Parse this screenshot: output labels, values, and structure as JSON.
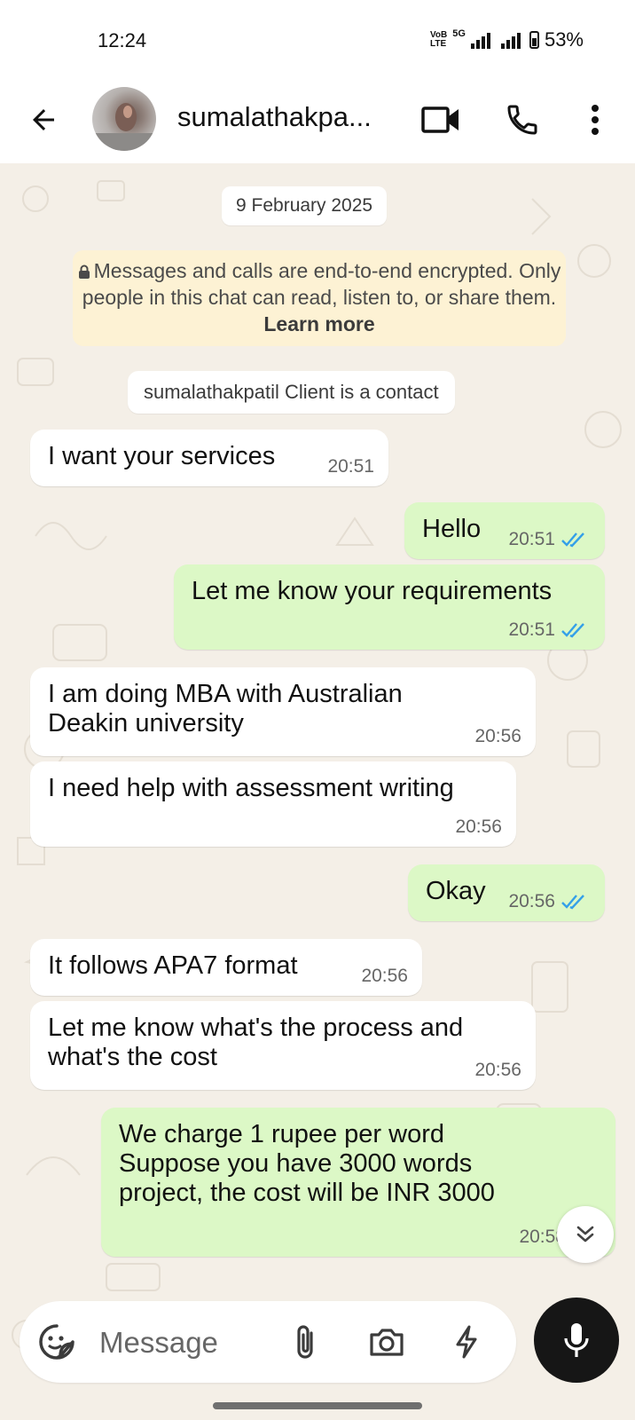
{
  "status_bar": {
    "time": "12:24",
    "network_label_top": "VoB",
    "network_label_bottom": "LTE",
    "network_type": "5G",
    "battery": "53%"
  },
  "header": {
    "contact_name": "sumalathakpa...",
    "icons": [
      "back-arrow-icon",
      "video-call-icon",
      "voice-call-icon",
      "more-options-icon"
    ]
  },
  "chat": {
    "date": "9 February 2025",
    "encryption_notice": {
      "text": "Messages and calls are end-to-end encrypted. Only people in this chat can read, listen to, or share them.",
      "link": "Learn more"
    },
    "contact_notice": "sumalathakpatil Client is a contact",
    "messages": [
      {
        "direction": "in",
        "text": "I want your services",
        "time": "20:51"
      },
      {
        "direction": "out",
        "text": "Hello",
        "time": "20:51",
        "status": "read"
      },
      {
        "direction": "out",
        "text": "Let me know your requirements",
        "time": "20:51",
        "status": "read"
      },
      {
        "direction": "in",
        "text": "I am doing MBA with Australian\nDeakin university",
        "time": "20:56"
      },
      {
        "direction": "in",
        "text": "I need help with assessment writing",
        "time": "20:56"
      },
      {
        "direction": "out",
        "text": "Okay",
        "time": "20:56",
        "status": "read"
      },
      {
        "direction": "in",
        "text": "It follows APA7 format",
        "time": "20:56"
      },
      {
        "direction": "in",
        "text": "Let me know what's the process and\nwhat's the cost",
        "time": "20:56"
      },
      {
        "direction": "out",
        "text": "We charge 1 rupee per word\nSuppose you have 3000 words\nproject, the cost will be INR 3000",
        "time": "20:58",
        "status": "read"
      }
    ]
  },
  "input_bar": {
    "placeholder": "Message",
    "icons": [
      "sticker-icon",
      "attachment-icon",
      "camera-icon",
      "lightning-icon",
      "microphone-icon"
    ]
  },
  "colors": {
    "chat_background": "#f4efe7",
    "incoming_bubble": "#ffffff",
    "outgoing_bubble": "#dcf8c6",
    "read_ticks": "#34a0e8",
    "encryption_notice_bg": "#fdf2d4",
    "mic_button": "#161616"
  }
}
